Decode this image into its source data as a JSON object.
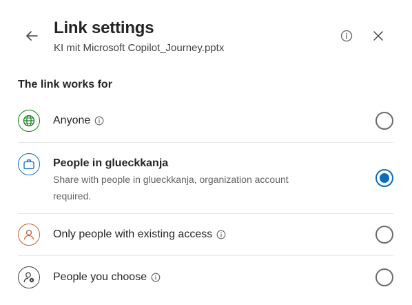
{
  "header": {
    "title": "Link settings",
    "subtitle": "KI mit Microsoft Copilot_Journey.pptx"
  },
  "section": {
    "label": "The link works for"
  },
  "options": [
    {
      "label": "Anyone",
      "description": "",
      "selected": false,
      "icon": "globe-icon",
      "icon_color": "#107c10"
    },
    {
      "label": "People in glueckkanja",
      "description": "Share with people in glueckkanja, organization account required.",
      "selected": true,
      "icon": "briefcase-icon",
      "icon_color": "#0f6cbd"
    },
    {
      "label": "Only people with existing access",
      "description": "",
      "selected": false,
      "icon": "person-icon",
      "icon_color": "#c25e2e"
    },
    {
      "label": "People you choose",
      "description": "",
      "selected": false,
      "icon": "person-settings-icon",
      "icon_color": "#424242"
    }
  ],
  "colors": {
    "accent": "#0f6cbd",
    "text": "#242424",
    "secondary_text": "#616161"
  }
}
